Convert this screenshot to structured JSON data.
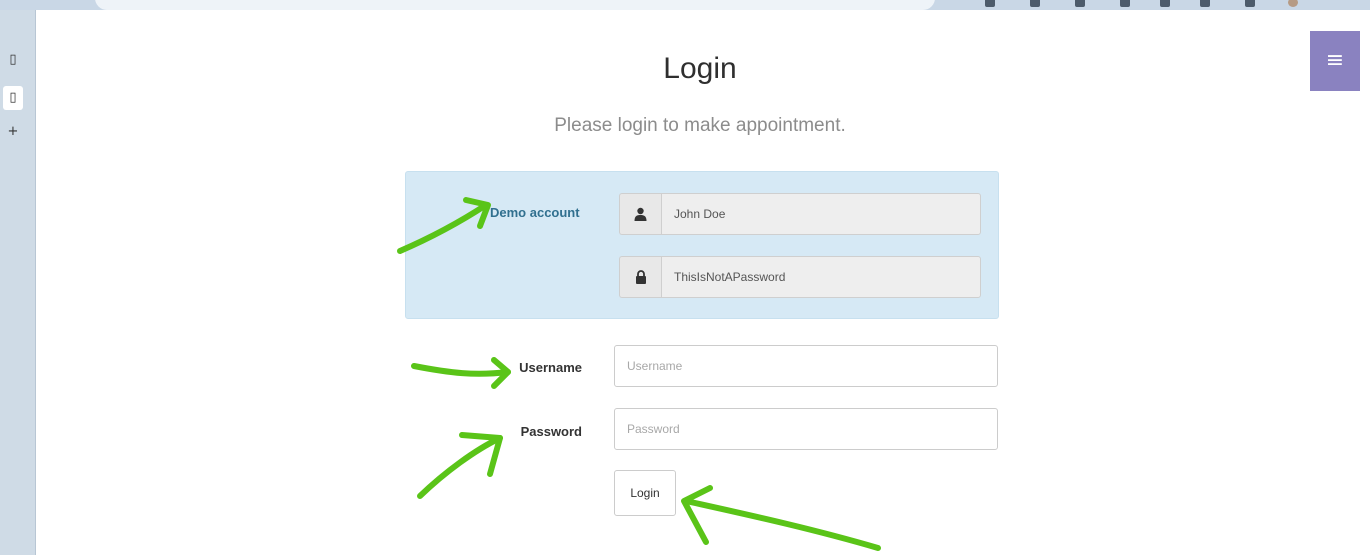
{
  "sidebar_toggle": {
    "icon": "hamburger-menu-icon",
    "glyph": "≡"
  },
  "rail": {
    "items": [
      {
        "icon": "page-icon",
        "glyph": "▯"
      },
      {
        "icon": "page-icon",
        "glyph": "▯"
      },
      {
        "icon": "plus-icon",
        "glyph": "+"
      }
    ]
  },
  "page": {
    "title": "Login",
    "subtitle": "Please login to make appointment."
  },
  "demo_account": {
    "label": "Demo account",
    "username": "John Doe",
    "password": "ThisIsNotAPassword",
    "user_icon": "user-icon",
    "lock_icon": "lock-icon"
  },
  "form": {
    "username_label": "Username",
    "username_placeholder": "Username",
    "password_label": "Password",
    "password_placeholder": "Password",
    "submit_label": "Login"
  },
  "colors": {
    "menu_toggle": "#8a82c0",
    "demo_panel": "#d6e9f5",
    "annotation_arrow": "#5ac418"
  }
}
